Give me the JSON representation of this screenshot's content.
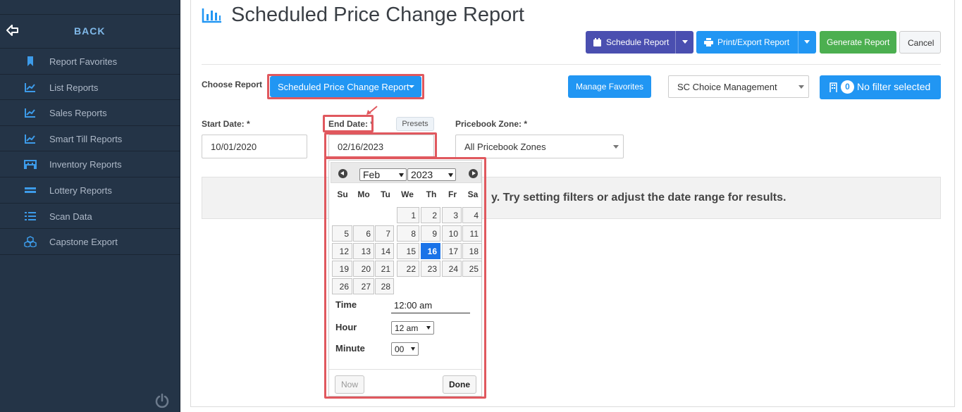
{
  "sidebar": {
    "back_label": "BACK",
    "items": [
      {
        "label": "Report Favorites",
        "icon": "bookmark-icon"
      },
      {
        "label": "List Reports",
        "icon": "line-chart-icon"
      },
      {
        "label": "Sales Reports",
        "icon": "line-chart-icon"
      },
      {
        "label": "Smart Till Reports",
        "icon": "line-chart-icon"
      },
      {
        "label": "Inventory Reports",
        "icon": "warehouse-icon"
      },
      {
        "label": "Lottery Reports",
        "icon": "ticket-icon"
      },
      {
        "label": "Scan Data",
        "icon": "list-icon"
      },
      {
        "label": "Capstone Export",
        "icon": "cubes-icon"
      }
    ]
  },
  "header": {
    "title": "Scheduled Price Change Report",
    "buttons": {
      "schedule": "Schedule Report",
      "print_export": "Print/Export Report",
      "generate": "Generate Report",
      "cancel": "Cancel"
    }
  },
  "filters": {
    "choose_report_label": "Choose Report",
    "report_dropdown": "Scheduled Price Change Report",
    "manage_favorites": "Manage Favorites",
    "store_select": "SC Choice Management",
    "filter_count": "0",
    "filter_text": "No filter selected",
    "start_date_label": "Start Date: *",
    "start_date_value": "10/01/2020",
    "end_date_label": "End Date: *",
    "end_date_value": "02/16/2023",
    "presets": "Presets",
    "pricebook_label": "Pricebook Zone: *",
    "pricebook_value": "All Pricebook Zones"
  },
  "message": "y. Try setting filters or adjust the date range for results.",
  "datepicker": {
    "month": "Feb",
    "year": "2023",
    "weekdays": [
      "Su",
      "Mo",
      "Tu",
      "We",
      "Th",
      "Fr",
      "Sa"
    ],
    "weeks": [
      [
        "",
        "",
        "",
        "1",
        "2",
        "3",
        "4"
      ],
      [
        "5",
        "6",
        "7",
        "8",
        "9",
        "10",
        "11"
      ],
      [
        "12",
        "13",
        "14",
        "15",
        "16",
        "17",
        "18"
      ],
      [
        "19",
        "20",
        "21",
        "22",
        "23",
        "24",
        "25"
      ],
      [
        "26",
        "27",
        "28",
        "",
        "",
        "",
        ""
      ]
    ],
    "selected_day": "16",
    "time_label": "Time",
    "time_value": "12:00 am",
    "hour_label": "Hour",
    "hour_value": "12 am",
    "minute_label": "Minute",
    "minute_value": "00",
    "now_button": "Now",
    "done_button": "Done"
  },
  "colors": {
    "sidebar_bg": "#243447",
    "schedule_btn": "#4a4fb0",
    "primary_blue": "#2196f3",
    "generate_green": "#4caf50",
    "highlight_red": "#e0585e",
    "selected_day": "#1a73e8"
  }
}
